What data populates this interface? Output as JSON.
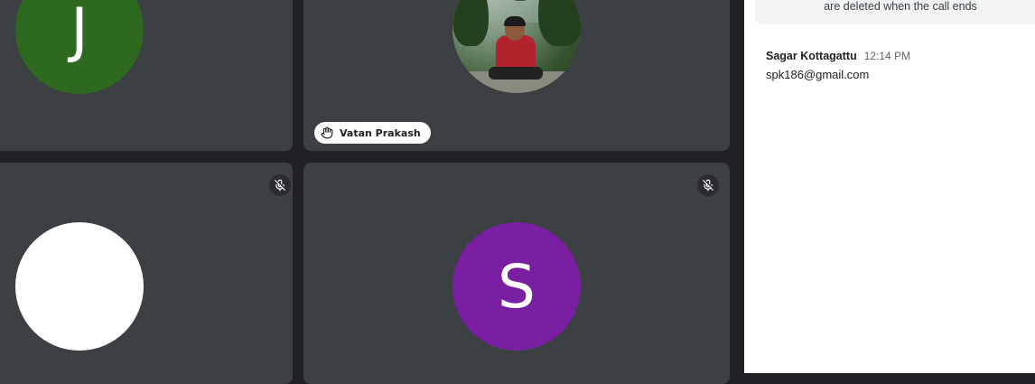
{
  "tiles": {
    "top_left": {
      "initial": "J",
      "avatar_color": "#2d6a1f"
    },
    "top_right": {
      "name_chip": "Vatan Prakash",
      "hand_raised": true,
      "avatar": "photo"
    },
    "bottom_left": {
      "avatar_color": "#ffffff",
      "muted": true
    },
    "bottom_right": {
      "initial": "S",
      "avatar_color": "#7b1fa2",
      "muted": true
    }
  },
  "chat": {
    "notice": "are deleted when the call ends",
    "messages": [
      {
        "sender": "Sagar Kottagattu",
        "time": "12:14 PM",
        "text": "spk186@gmail.com"
      }
    ]
  },
  "icons": {
    "hand": "raised-hand-icon",
    "mic_off": "mic-off-icon"
  }
}
